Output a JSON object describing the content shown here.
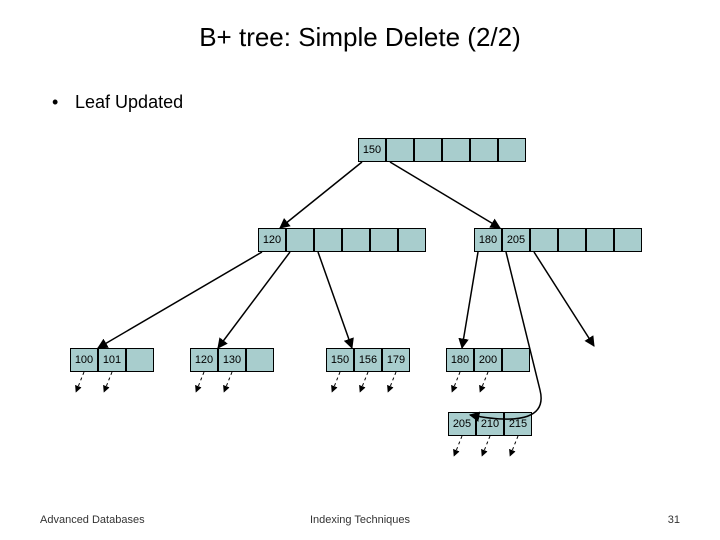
{
  "title": "B+ tree: Simple Delete (2/2)",
  "bullet": "Leaf Updated",
  "root": {
    "cells": [
      "150",
      "",
      "",
      "",
      "",
      ""
    ]
  },
  "mid_left": {
    "cells": [
      "120",
      "",
      "",
      "",
      "",
      ""
    ]
  },
  "mid_right": {
    "cells": [
      "180",
      "205",
      "",
      "",
      "",
      ""
    ]
  },
  "leaf1": {
    "cells": [
      "100",
      "101",
      ""
    ]
  },
  "leaf2": {
    "cells": [
      "120",
      "130",
      ""
    ]
  },
  "leaf3": {
    "cells": [
      "150",
      "156",
      "179"
    ]
  },
  "leaf4": {
    "cells": [
      "180",
      "200",
      ""
    ]
  },
  "leaf5": {
    "cells": [
      "205",
      "210",
      "215"
    ]
  },
  "footer": {
    "left": "Advanced Databases",
    "center": "Indexing Techniques",
    "right": "31"
  }
}
